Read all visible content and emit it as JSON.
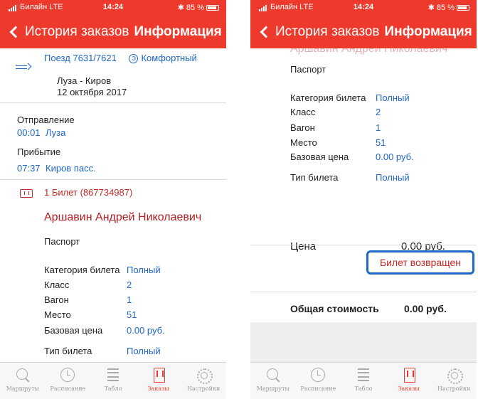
{
  "status": {
    "carrier": "Билайн  LTE",
    "time": "14:24",
    "battery": "85 %"
  },
  "nav": {
    "back_label": "История заказов",
    "title": "Информация"
  },
  "train": {
    "label": "Поезд  7631/7621",
    "comfort_icon": "Э",
    "class_label": "Комфортный",
    "route": "Луза - Киров",
    "date": "12 октября 2017"
  },
  "departure": {
    "label": "Отправление",
    "time": "00:01",
    "station": "Луза"
  },
  "arrival": {
    "label": "Прибытие",
    "time": "07:37",
    "station": "Киров пасс."
  },
  "ticket": {
    "header": "1 Билет (867734987)",
    "passenger": "Аршавин Андрей Николаевич",
    "document": "Паспорт",
    "category_label": "Категория билета",
    "category_value": "Полный",
    "class_label": "Класс",
    "class_value": "2",
    "car_label": "Вагон",
    "car_value": "1",
    "seat_label": "Место",
    "seat_value": "51",
    "base_price_label": "Базовая цена",
    "base_price_value": "0.00 руб.",
    "type_label": "Тип билета",
    "type_value": "Полный"
  },
  "summary": {
    "price_label": "Цена",
    "price_value": "0.00 руб.",
    "status": "Билет возвращен",
    "total_label": "Общая стоимость",
    "total_value": "0.00 руб."
  },
  "tabs": [
    {
      "label": "Маршруты",
      "icon": "search-icon"
    },
    {
      "label": "Расписание",
      "icon": "clock-icon"
    },
    {
      "label": "Табло",
      "icon": "board-icon"
    },
    {
      "label": "Заказы",
      "icon": "orders-icon"
    },
    {
      "label": "Настройки",
      "icon": "gear-icon"
    }
  ],
  "colors": {
    "accent": "#ee3a2c",
    "link": "#1e66c8",
    "passenger": "#b31c22"
  }
}
